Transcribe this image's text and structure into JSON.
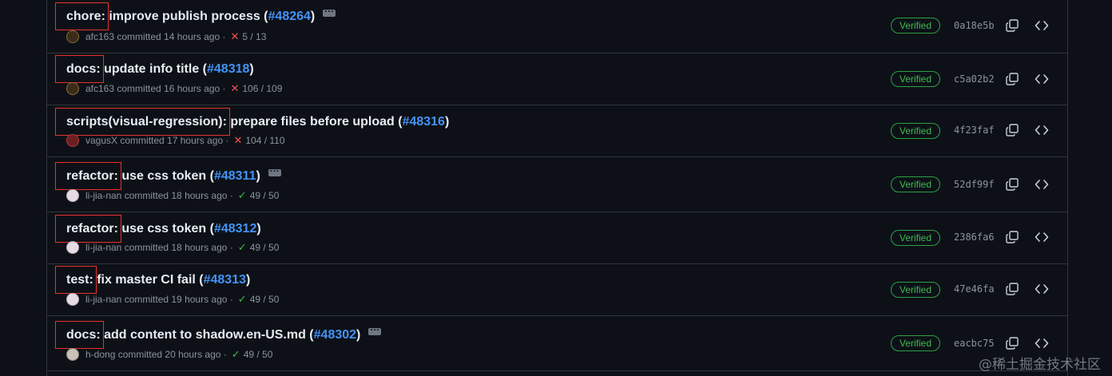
{
  "colors": {
    "background": "#0d1117",
    "border": "#30363d",
    "text": "#e6edf3",
    "muted": "#8b949e",
    "link": "#4493f8",
    "verified": "#3fb950",
    "failure": "#f85149",
    "highlight_box": "#e5322d"
  },
  "commits": [
    {
      "prefix": "chore:",
      "message": " improve publish process (",
      "pr": "#48264",
      "close": ")",
      "has_ellipsis": true,
      "author": "afc163",
      "committed": "committed 14 hours ago ·",
      "status": "fail",
      "status_icon": "x-icon",
      "checks": "5 / 13",
      "verified": "Verified",
      "sha": "0a18e5b"
    },
    {
      "prefix": "docs:",
      "message": " update info title (",
      "pr": "#48318",
      "close": ")",
      "has_ellipsis": false,
      "author": "afc163",
      "committed": "committed 16 hours ago ·",
      "status": "fail",
      "status_icon": "x-icon",
      "checks": "106 / 109",
      "verified": "Verified",
      "sha": "c5a02b2"
    },
    {
      "prefix": "scripts(visual-regression):",
      "message": " prepare files before upload (",
      "pr": "#48316",
      "close": ")",
      "has_ellipsis": false,
      "author": "vagusX",
      "committed": "committed 17 hours ago ·",
      "status": "fail",
      "status_icon": "x-icon",
      "checks": "104 / 110",
      "verified": "Verified",
      "sha": "4f23faf"
    },
    {
      "prefix": "refactor:",
      "message": " use css token (",
      "pr": "#48311",
      "close": ")",
      "has_ellipsis": true,
      "author": "li-jia-nan",
      "committed": "committed 18 hours ago ·",
      "status": "success",
      "status_icon": "check-icon",
      "checks": "49 / 50",
      "verified": "Verified",
      "sha": "52df99f"
    },
    {
      "prefix": "refactor:",
      "message": " use css token (",
      "pr": "#48312",
      "close": ")",
      "has_ellipsis": false,
      "author": "li-jia-nan",
      "committed": "committed 18 hours ago ·",
      "status": "success",
      "status_icon": "check-icon",
      "checks": "49 / 50",
      "verified": "Verified",
      "sha": "2386fa6"
    },
    {
      "prefix": "test:",
      "message": " fix master CI fail (",
      "pr": "#48313",
      "close": ")",
      "has_ellipsis": false,
      "author": "li-jia-nan",
      "committed": "committed 19 hours ago ·",
      "status": "success",
      "status_icon": "check-icon",
      "checks": "49 / 50",
      "verified": "Verified",
      "sha": "47e46fa"
    },
    {
      "prefix": "docs:",
      "message": " add content to shadow.en-US.md (",
      "pr": "#48302",
      "close": ")",
      "has_ellipsis": true,
      "author": "h-dong",
      "committed": "committed 20 hours ago ·",
      "status": "success",
      "status_icon": "check-icon",
      "checks": "49 / 50",
      "verified": "Verified",
      "sha": "eacbc75"
    }
  ],
  "watermark": "@稀土掘金技术社区"
}
